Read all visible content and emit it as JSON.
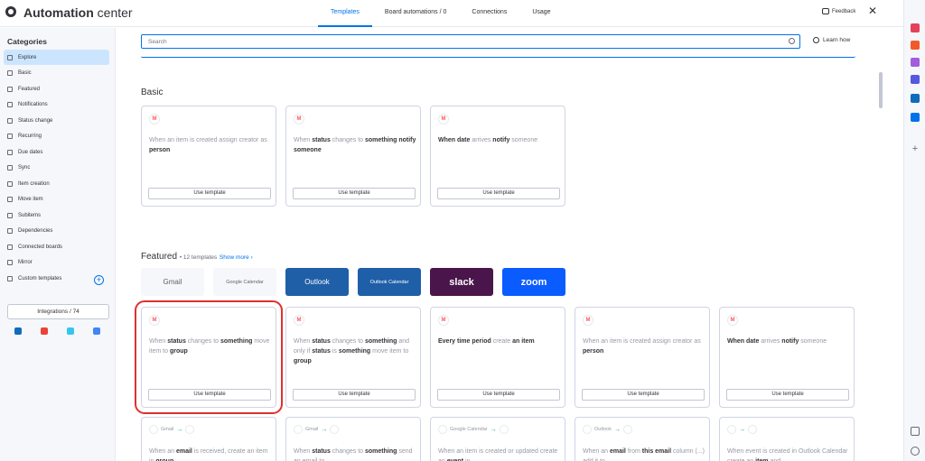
{
  "app": {
    "title_bold": "Automation",
    "title_rest": " center"
  },
  "tabs": [
    {
      "label": "Templates",
      "active": true
    },
    {
      "label": "Board automations / 0",
      "active": false
    },
    {
      "label": "Connections",
      "active": false
    },
    {
      "label": "Usage",
      "active": false
    }
  ],
  "header": {
    "feedback_label": "Feedback",
    "close_glyph": "✕"
  },
  "sidebar": {
    "title": "Categories",
    "items": [
      {
        "label": "Explore",
        "icon": "rocket-icon",
        "active": true
      },
      {
        "label": "Basic",
        "icon": "person-icon"
      },
      {
        "label": "Featured",
        "icon": "diamond-icon"
      },
      {
        "label": "Notifications",
        "icon": "bell-icon"
      },
      {
        "label": "Status change",
        "icon": "status-icon"
      },
      {
        "label": "Recurring",
        "icon": "recurring-icon"
      },
      {
        "label": "Due dates",
        "icon": "calendar-icon"
      },
      {
        "label": "Sync",
        "icon": "sync-icon"
      },
      {
        "label": "Item creation",
        "icon": "plus-icon"
      },
      {
        "label": "Move item",
        "icon": "arrow-icon"
      },
      {
        "label": "Subitems",
        "icon": "subitems-icon"
      },
      {
        "label": "Dependencies",
        "icon": "dependency-icon"
      },
      {
        "label": "Connected boards",
        "icon": "link-icon"
      },
      {
        "label": "Mirror",
        "icon": "mirror-icon"
      },
      {
        "label": "Custom templates",
        "icon": "custom-icon"
      }
    ],
    "add_glyph": "+",
    "integrations_label": "Integrations / 74"
  },
  "search": {
    "placeholder": "Search",
    "learn_label": "Learn how"
  },
  "basic": {
    "title": "Basic",
    "use_label": "Use template",
    "cards": [
      {
        "parts": [
          [
            "When an item is created assign creator as ",
            false
          ],
          [
            "person",
            true
          ]
        ]
      },
      {
        "parts": [
          [
            "When ",
            false
          ],
          [
            "status",
            true
          ],
          [
            " changes to ",
            false
          ],
          [
            "something notify someone",
            true
          ]
        ]
      },
      {
        "parts": [
          [
            "When date",
            true
          ],
          [
            " arrives ",
            false
          ],
          [
            "notify",
            true
          ],
          [
            " someone",
            false
          ]
        ]
      }
    ]
  },
  "featured": {
    "title": "Featured",
    "count": "• 12 templates",
    "show_more": "Show more ›",
    "brands": [
      {
        "label": "Gmail",
        "bg": "#f6f7fb",
        "fg": "#5f6368"
      },
      {
        "label": "Google Calendar",
        "bg": "#f6f7fb",
        "fg": "#5f6368"
      },
      {
        "label": "Outlook",
        "bg": "#1f5fa8",
        "fg": "#ffffff"
      },
      {
        "label": "Outlook Calendar",
        "bg": "#1f5fa8",
        "fg": "#ffffff"
      },
      {
        "label": "slack",
        "bg": "#4a154b",
        "fg": "#ffffff"
      },
      {
        "label": "zoom",
        "bg": "#0b5cff",
        "fg": "#ffffff"
      }
    ],
    "use_label": "Use template",
    "cards": [
      {
        "parts": [
          [
            "When ",
            false
          ],
          [
            "status",
            true
          ],
          [
            " changes to ",
            false
          ],
          [
            "something",
            true
          ],
          [
            " move item to ",
            false
          ],
          [
            "group",
            true
          ]
        ]
      },
      {
        "parts": [
          [
            "When ",
            false
          ],
          [
            "status",
            true
          ],
          [
            " changes to ",
            false
          ],
          [
            "something",
            true
          ],
          [
            " and only if ",
            false
          ],
          [
            "status",
            true
          ],
          [
            " is ",
            false
          ],
          [
            "something",
            true
          ],
          [
            " move item to ",
            false
          ],
          [
            "group",
            true
          ]
        ]
      },
      {
        "parts": [
          [
            "Every time period",
            true
          ],
          [
            " create ",
            false
          ],
          [
            "an item",
            true
          ]
        ]
      },
      {
        "parts": [
          [
            "When an item is created assign creator as ",
            false
          ],
          [
            "person",
            true
          ]
        ]
      },
      {
        "parts": [
          [
            "When date",
            true
          ],
          [
            " arrives ",
            false
          ],
          [
            "notify",
            true
          ],
          [
            " someone",
            false
          ]
        ]
      }
    ],
    "row2": [
      {
        "chain": "Gmail",
        "parts": [
          [
            "When an ",
            false
          ],
          [
            "email",
            true
          ],
          [
            " is received, create an item in ",
            false
          ],
          [
            "group",
            true
          ]
        ]
      },
      {
        "chain": "Gmail",
        "parts": [
          [
            "When ",
            false
          ],
          [
            "status",
            true
          ],
          [
            " changes to ",
            false
          ],
          [
            "something",
            true
          ],
          [
            " send an email to",
            false
          ]
        ]
      },
      {
        "chain": "Google Calendar",
        "parts": [
          [
            "When an item is created or updated create an ",
            false
          ],
          [
            "event",
            true
          ],
          [
            " in",
            false
          ]
        ]
      },
      {
        "chain": "Outlook",
        "parts": [
          [
            "When an ",
            false
          ],
          [
            "email",
            true
          ],
          [
            " from ",
            false
          ],
          [
            "this email",
            true
          ],
          [
            " column (...) add it to",
            false
          ]
        ]
      },
      {
        "chain": "",
        "parts": [
          [
            "When event is created in Outlook Calendar create an ",
            false
          ],
          [
            "item",
            true
          ],
          [
            " and",
            false
          ]
        ]
      }
    ]
  },
  "colors": {
    "accent": "#0073ea",
    "highlight": "#e03030",
    "sidebar_active": "#cce5ff"
  }
}
